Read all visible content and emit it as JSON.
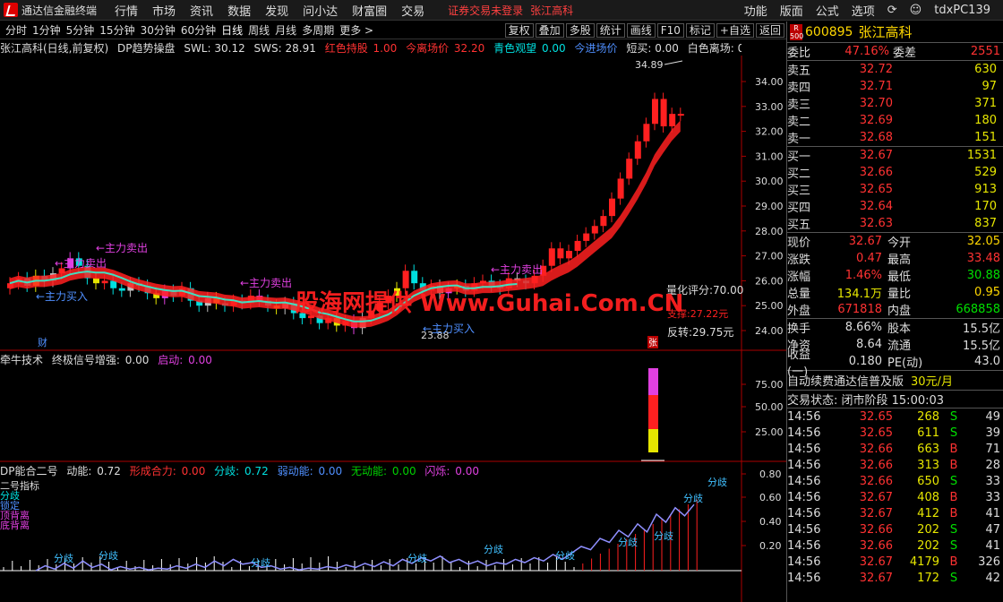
{
  "app": {
    "name": "通达信金融终端",
    "menus": [
      "行情",
      "市场",
      "资讯",
      "数据",
      "发现",
      "问小达",
      "财富圈",
      "交易"
    ],
    "warn": "证券交易未登录",
    "stock_link": "张江高科",
    "right_menus": [
      "功能",
      "版面",
      "公式",
      "选项"
    ],
    "user": "tdxPC139"
  },
  "toolbar": {
    "periods": [
      "分时",
      "1分钟",
      "5分钟",
      "15分钟",
      "30分钟",
      "60分钟",
      "日线",
      "周线",
      "月线",
      "多周期",
      "更多 >"
    ],
    "buttons": [
      "复权",
      "叠加",
      "多股",
      "统计",
      "画线",
      "F10",
      "标记",
      "+自选",
      "返回"
    ]
  },
  "chart_header": {
    "title": "张江高科(日线,前复权)",
    "indicator": "DP趋势操盘",
    "swl": "SWL: 30.12",
    "sws": "SWS: 28.91",
    "hold": "红色持股",
    "hold_v": "1.00",
    "today": "今离场价",
    "today_v": "32.20",
    "cyan": "青色观望",
    "cyan_v": "0.00",
    "enter": "今进场价",
    "short": "短买: 0.00",
    "white": "白色离场: 0.",
    "mark": "◇"
  },
  "main_axis": [
    "34.00",
    "33.00",
    "32.00",
    "31.00",
    "30.00",
    "29.00",
    "28.00",
    "27.00",
    "26.00",
    "25.00",
    "24.00"
  ],
  "annotations": {
    "high": "34.89",
    "low": "23.88",
    "sell1": "主力卖出",
    "sell2": "主力卖出",
    "sell3": "主力卖出",
    "sell4": "主力卖出",
    "buy1": "主力买入",
    "buy2": "主力买入",
    "score": "量化评分:70.00",
    "support": "支撑:27.22元",
    "reverse": "反转:29.75元",
    "cai": "财",
    "zhang": "张"
  },
  "watermark": "股海网提供 Www.Guhai.Com.CN",
  "sub1": {
    "title": "牵牛技术",
    "label": "终极信号增强:",
    "value": "0.00",
    "start": "启动:",
    "start_v": "0.00",
    "axis": [
      "75.00",
      "50.00",
      "25.00"
    ]
  },
  "sub2": {
    "title": "DP能合二号",
    "dn": "动能:",
    "dn_v": "0.72",
    "xc": "形成合力:",
    "xc_v": "0.00",
    "fq": "分歧:",
    "fq_v": "0.72",
    "rd": "弱动能:",
    "rd_v": "0.00",
    "wd": "无动能:",
    "wd_v": "0.00",
    "sl": "闪烁:",
    "sl_v": "0.00",
    "legend": [
      "二号指标",
      "分歧",
      "锁定",
      "顶背离",
      "底背离"
    ],
    "axis": [
      "0.80",
      "0.60",
      "0.40",
      "0.20"
    ],
    "label_fq": "分歧"
  },
  "quote": {
    "code": "600895",
    "name": "张江高科",
    "badge": "R 500",
    "webi_l": "委比",
    "webi": "47.16%",
    "weicha_l": "委差",
    "weicha": "2551",
    "asks": [
      {
        "l": "卖五",
        "p": "32.72",
        "q": "630"
      },
      {
        "l": "卖四",
        "p": "32.71",
        "q": "97"
      },
      {
        "l": "卖三",
        "p": "32.70",
        "q": "371"
      },
      {
        "l": "卖二",
        "p": "32.69",
        "q": "180"
      },
      {
        "l": "卖一",
        "p": "32.68",
        "q": "151"
      }
    ],
    "bids": [
      {
        "l": "买一",
        "p": "32.67",
        "q": "1531"
      },
      {
        "l": "买二",
        "p": "32.66",
        "q": "529"
      },
      {
        "l": "买三",
        "p": "32.65",
        "q": "913"
      },
      {
        "l": "买四",
        "p": "32.64",
        "q": "170"
      },
      {
        "l": "买五",
        "p": "32.63",
        "q": "837"
      }
    ],
    "stats": [
      [
        "现价",
        "32.67",
        "今开",
        "32.05"
      ],
      [
        "涨跌",
        "0.47",
        "最高",
        "33.48"
      ],
      [
        "涨幅",
        "1.46%",
        "最低",
        "30.88"
      ],
      [
        "总量",
        "134.1万",
        "量比",
        "0.95"
      ],
      [
        "外盘",
        "671818",
        "内盘",
        "668858"
      ]
    ],
    "stats2": [
      [
        "换手",
        "8.66%",
        "股本",
        "15.5亿"
      ],
      [
        "净资",
        "8.64",
        "流通",
        "15.5亿"
      ],
      [
        "收益(一)",
        "0.180",
        "PE(动)",
        "43.0"
      ]
    ],
    "ad": "自动续费通达信普及版",
    "ad_price": "30元/月",
    "status": "交易状态: 闭市阶段 15:00:03",
    "ticks": [
      [
        "14:56",
        "32.65",
        "268",
        "S",
        "49"
      ],
      [
        "14:56",
        "32.65",
        "611",
        "S",
        "39"
      ],
      [
        "14:56",
        "32.66",
        "663",
        "B",
        "71"
      ],
      [
        "14:56",
        "32.66",
        "313",
        "B",
        "28"
      ],
      [
        "14:56",
        "32.66",
        "650",
        "S",
        "33"
      ],
      [
        "14:56",
        "32.67",
        "408",
        "B",
        "33"
      ],
      [
        "14:56",
        "32.67",
        "412",
        "B",
        "41"
      ],
      [
        "14:56",
        "32.66",
        "202",
        "S",
        "47"
      ],
      [
        "14:56",
        "32.66",
        "202",
        "S",
        "41"
      ],
      [
        "14:56",
        "32.67",
        "4179",
        "B",
        "326"
      ],
      [
        "14:56",
        "32.67",
        "172",
        "S",
        "42"
      ]
    ]
  }
}
